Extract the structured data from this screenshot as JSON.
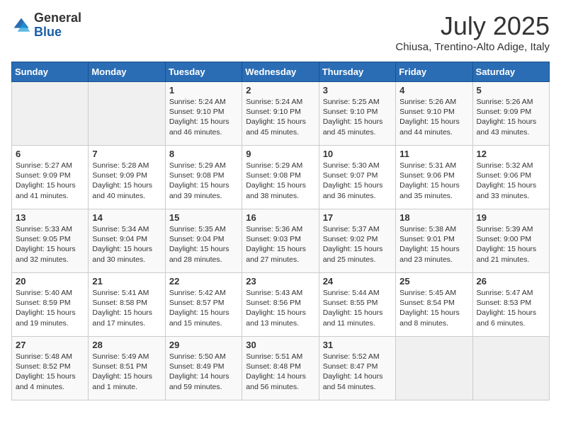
{
  "header": {
    "logo_general": "General",
    "logo_blue": "Blue",
    "month": "July 2025",
    "location": "Chiusa, Trentino-Alto Adige, Italy"
  },
  "weekdays": [
    "Sunday",
    "Monday",
    "Tuesday",
    "Wednesday",
    "Thursday",
    "Friday",
    "Saturday"
  ],
  "weeks": [
    [
      {
        "day": "",
        "info": ""
      },
      {
        "day": "",
        "info": ""
      },
      {
        "day": "1",
        "info": "Sunrise: 5:24 AM\nSunset: 9:10 PM\nDaylight: 15 hours and 46 minutes."
      },
      {
        "day": "2",
        "info": "Sunrise: 5:24 AM\nSunset: 9:10 PM\nDaylight: 15 hours and 45 minutes."
      },
      {
        "day": "3",
        "info": "Sunrise: 5:25 AM\nSunset: 9:10 PM\nDaylight: 15 hours and 45 minutes."
      },
      {
        "day": "4",
        "info": "Sunrise: 5:26 AM\nSunset: 9:10 PM\nDaylight: 15 hours and 44 minutes."
      },
      {
        "day": "5",
        "info": "Sunrise: 5:26 AM\nSunset: 9:09 PM\nDaylight: 15 hours and 43 minutes."
      }
    ],
    [
      {
        "day": "6",
        "info": "Sunrise: 5:27 AM\nSunset: 9:09 PM\nDaylight: 15 hours and 41 minutes."
      },
      {
        "day": "7",
        "info": "Sunrise: 5:28 AM\nSunset: 9:09 PM\nDaylight: 15 hours and 40 minutes."
      },
      {
        "day": "8",
        "info": "Sunrise: 5:29 AM\nSunset: 9:08 PM\nDaylight: 15 hours and 39 minutes."
      },
      {
        "day": "9",
        "info": "Sunrise: 5:29 AM\nSunset: 9:08 PM\nDaylight: 15 hours and 38 minutes."
      },
      {
        "day": "10",
        "info": "Sunrise: 5:30 AM\nSunset: 9:07 PM\nDaylight: 15 hours and 36 minutes."
      },
      {
        "day": "11",
        "info": "Sunrise: 5:31 AM\nSunset: 9:06 PM\nDaylight: 15 hours and 35 minutes."
      },
      {
        "day": "12",
        "info": "Sunrise: 5:32 AM\nSunset: 9:06 PM\nDaylight: 15 hours and 33 minutes."
      }
    ],
    [
      {
        "day": "13",
        "info": "Sunrise: 5:33 AM\nSunset: 9:05 PM\nDaylight: 15 hours and 32 minutes."
      },
      {
        "day": "14",
        "info": "Sunrise: 5:34 AM\nSunset: 9:04 PM\nDaylight: 15 hours and 30 minutes."
      },
      {
        "day": "15",
        "info": "Sunrise: 5:35 AM\nSunset: 9:04 PM\nDaylight: 15 hours and 28 minutes."
      },
      {
        "day": "16",
        "info": "Sunrise: 5:36 AM\nSunset: 9:03 PM\nDaylight: 15 hours and 27 minutes."
      },
      {
        "day": "17",
        "info": "Sunrise: 5:37 AM\nSunset: 9:02 PM\nDaylight: 15 hours and 25 minutes."
      },
      {
        "day": "18",
        "info": "Sunrise: 5:38 AM\nSunset: 9:01 PM\nDaylight: 15 hours and 23 minutes."
      },
      {
        "day": "19",
        "info": "Sunrise: 5:39 AM\nSunset: 9:00 PM\nDaylight: 15 hours and 21 minutes."
      }
    ],
    [
      {
        "day": "20",
        "info": "Sunrise: 5:40 AM\nSunset: 8:59 PM\nDaylight: 15 hours and 19 minutes."
      },
      {
        "day": "21",
        "info": "Sunrise: 5:41 AM\nSunset: 8:58 PM\nDaylight: 15 hours and 17 minutes."
      },
      {
        "day": "22",
        "info": "Sunrise: 5:42 AM\nSunset: 8:57 PM\nDaylight: 15 hours and 15 minutes."
      },
      {
        "day": "23",
        "info": "Sunrise: 5:43 AM\nSunset: 8:56 PM\nDaylight: 15 hours and 13 minutes."
      },
      {
        "day": "24",
        "info": "Sunrise: 5:44 AM\nSunset: 8:55 PM\nDaylight: 15 hours and 11 minutes."
      },
      {
        "day": "25",
        "info": "Sunrise: 5:45 AM\nSunset: 8:54 PM\nDaylight: 15 hours and 8 minutes."
      },
      {
        "day": "26",
        "info": "Sunrise: 5:47 AM\nSunset: 8:53 PM\nDaylight: 15 hours and 6 minutes."
      }
    ],
    [
      {
        "day": "27",
        "info": "Sunrise: 5:48 AM\nSunset: 8:52 PM\nDaylight: 15 hours and 4 minutes."
      },
      {
        "day": "28",
        "info": "Sunrise: 5:49 AM\nSunset: 8:51 PM\nDaylight: 15 hours and 1 minute."
      },
      {
        "day": "29",
        "info": "Sunrise: 5:50 AM\nSunset: 8:49 PM\nDaylight: 14 hours and 59 minutes."
      },
      {
        "day": "30",
        "info": "Sunrise: 5:51 AM\nSunset: 8:48 PM\nDaylight: 14 hours and 56 minutes."
      },
      {
        "day": "31",
        "info": "Sunrise: 5:52 AM\nSunset: 8:47 PM\nDaylight: 14 hours and 54 minutes."
      },
      {
        "day": "",
        "info": ""
      },
      {
        "day": "",
        "info": ""
      }
    ]
  ]
}
